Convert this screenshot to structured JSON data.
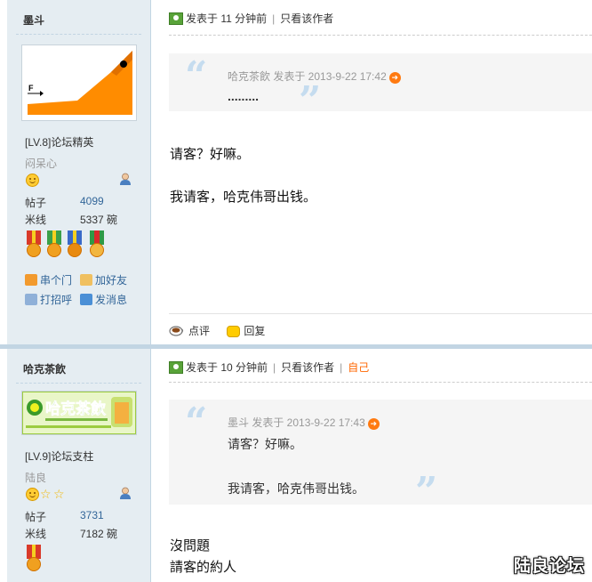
{
  "posts": [
    {
      "author": {
        "name": "墨斗",
        "level": "[LV.8]论坛精英",
        "nickname": "闷呆心",
        "avatar_label": "F",
        "stats": [
          {
            "label": "帖子",
            "value": "4099"
          },
          {
            "label": "米线",
            "value": "5337 碗"
          }
        ],
        "actions": [
          {
            "label": "串个门",
            "icon": "home-icon"
          },
          {
            "label": "加好友",
            "icon": "handshake-icon"
          },
          {
            "label": "打招呼",
            "icon": "wave-icon"
          },
          {
            "label": "发消息",
            "icon": "envelope-icon"
          }
        ]
      },
      "header": {
        "posted": "发表于 11 分钟前",
        "only_author": "只看该作者"
      },
      "quote": {
        "user_time": "哈克茶飲 发表于 2013-9-22 17:42",
        "text": "........."
      },
      "body": [
        "请客？好嘛。",
        "我请客，哈克伟哥出钱。"
      ],
      "footer": {
        "rate": "点评",
        "reply": "回复"
      }
    },
    {
      "author": {
        "name": "哈克茶飲",
        "level": "[LV.9]论坛支柱",
        "nickname": "陆良",
        "avatar_label": "哈克茶飲",
        "stats": [
          {
            "label": "帖子",
            "value": "3731"
          },
          {
            "label": "米线",
            "value": "7182 碗"
          }
        ]
      },
      "header": {
        "posted": "发表于 10 分钟前",
        "only_author": "只看该作者",
        "self": "自己"
      },
      "quote": {
        "user_time": "墨斗 发表于 2013-9-22 17:43",
        "lines": [
          "请客？好嘛。",
          "我请客，哈克伟哥出钱。"
        ]
      },
      "body": [
        "沒問題",
        "請客的約人"
      ]
    }
  ],
  "watermark": "陆良论坛",
  "colors": {
    "sidebar": "#e5edf2",
    "link": "#336699",
    "accent": "#ff6600",
    "quote_bg": "#f5f5f5"
  }
}
